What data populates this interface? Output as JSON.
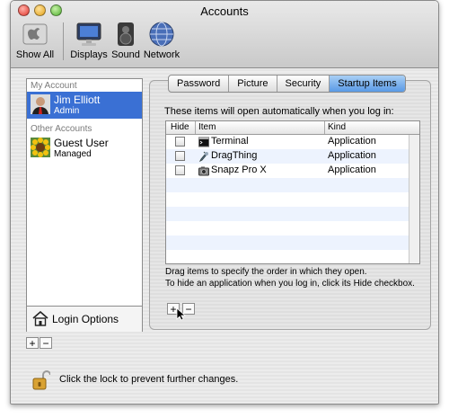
{
  "window": {
    "title": "Accounts"
  },
  "toolbar": {
    "items": [
      {
        "label": "Show All",
        "icon": "apple-icon"
      },
      {
        "label": "Displays",
        "icon": "display-icon"
      },
      {
        "label": "Sound",
        "icon": "speaker-icon"
      },
      {
        "label": "Network",
        "icon": "globe-icon"
      }
    ]
  },
  "sidebar": {
    "my_account_header": "My Account",
    "current_user": {
      "name": "Jim Elliott",
      "role": "Admin"
    },
    "other_accounts_header": "Other Accounts",
    "other_users": [
      {
        "name": "Guest User",
        "role": "Managed"
      }
    ],
    "login_options": "Login Options",
    "add_label": "+",
    "remove_label": "−"
  },
  "tabs": [
    {
      "label": "Password",
      "active": false
    },
    {
      "label": "Picture",
      "active": false
    },
    {
      "label": "Security",
      "active": false
    },
    {
      "label": "Startup Items",
      "active": true
    }
  ],
  "startup": {
    "heading": "These items will open automatically when you log in:",
    "columns": [
      "Hide",
      "Item",
      "Kind"
    ],
    "items": [
      {
        "name": "Terminal",
        "kind": "Application",
        "hidden": false,
        "icon": "terminal-icon"
      },
      {
        "name": "DragThing",
        "kind": "Application",
        "hidden": false,
        "icon": "dragthing-icon"
      },
      {
        "name": "Snapz Pro X",
        "kind": "Application",
        "hidden": false,
        "icon": "snapz-icon"
      }
    ],
    "note_line1": "Drag items to specify the order in which they open.",
    "note_line2": "To hide an application when you log in, click its Hide checkbox.",
    "add_label": "+",
    "remove_label": "−"
  },
  "footer": {
    "lock_text": "Click the lock to prevent further changes."
  },
  "colors": {
    "selection": "#3a70d4",
    "active_tab": "#5a9ae6"
  }
}
